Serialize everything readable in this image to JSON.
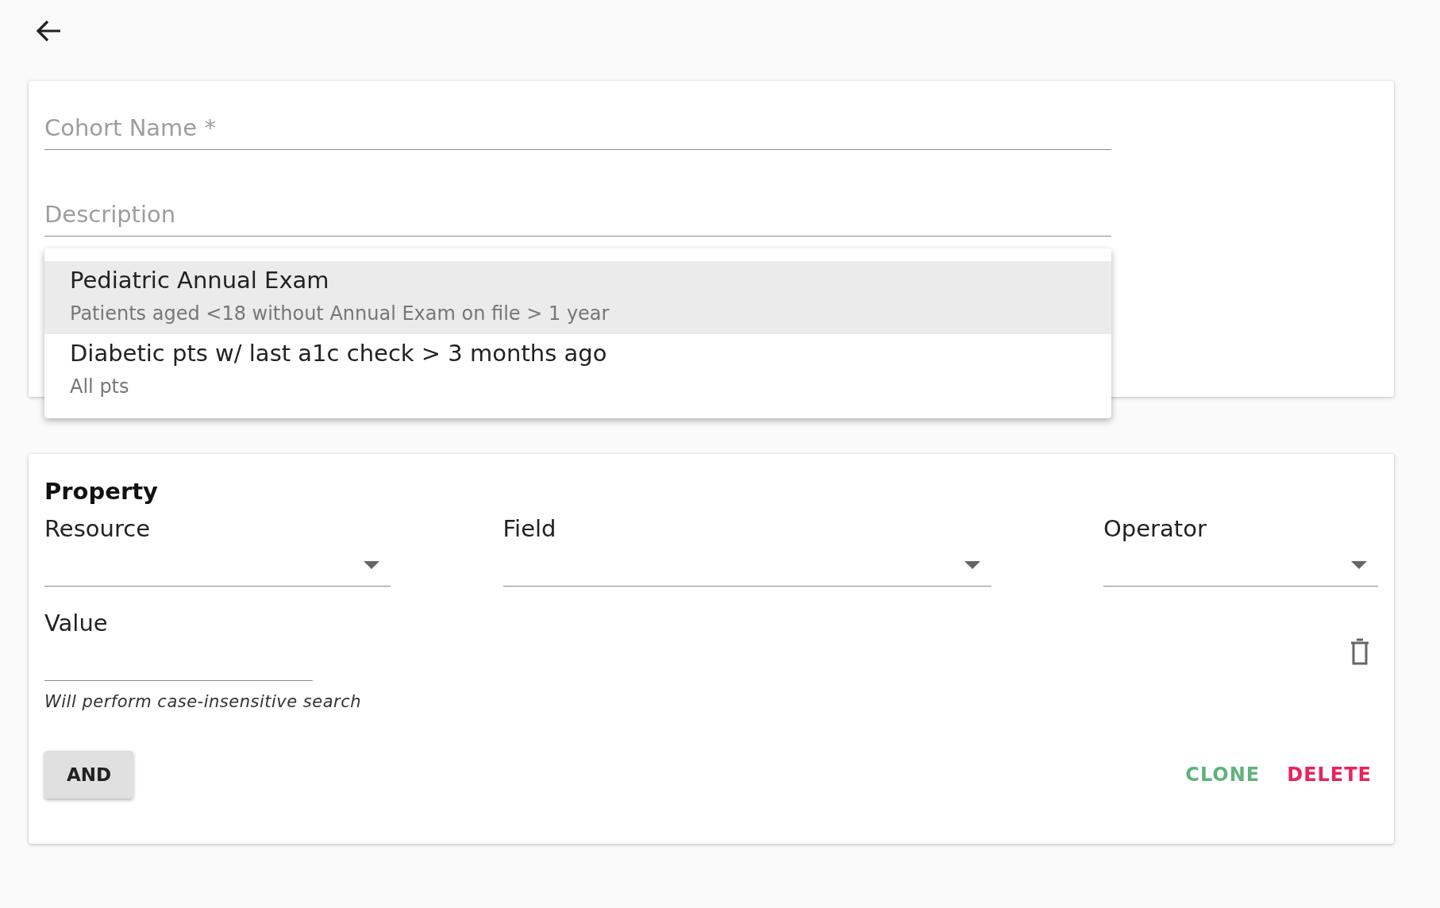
{
  "cohort": {
    "fields": [
      {
        "placeholder": "Cohort Name *"
      },
      {
        "placeholder": "Description"
      }
    ],
    "suggestions": [
      {
        "title": "Pediatric Annual Exam",
        "subtitle": "Patients aged <18 without Annual Exam on file > 1 year",
        "selected": true
      },
      {
        "title": "Diabetic pts w/ last a1c check > 3 months ago",
        "subtitle": "All pts",
        "selected": false
      }
    ]
  },
  "property": {
    "heading": "Property",
    "selects": [
      {
        "label": "Resource"
      },
      {
        "label": "Field"
      },
      {
        "label": "Operator"
      }
    ],
    "value": {
      "label": "Value",
      "helper": "Will perform case-insensitive search"
    },
    "combine_button": "AND",
    "actions": [
      {
        "label": "CLONE",
        "kind": "clone"
      },
      {
        "label": "DELETE",
        "kind": "delete"
      }
    ]
  }
}
